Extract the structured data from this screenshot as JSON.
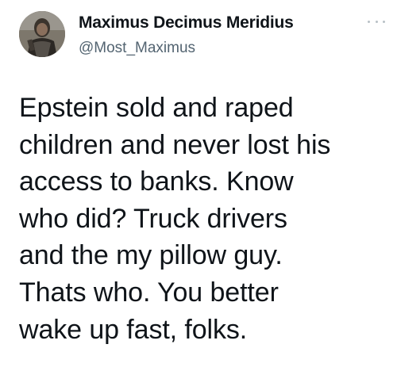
{
  "tweet": {
    "author": {
      "display_name": "Maximus Decimus Meridius",
      "handle": "@Most_Maximus",
      "avatar_icon": "gladiator-avatar"
    },
    "more_icon": "more-options-icon",
    "text_lines": [
      "Epstein sold and raped",
      "children and never lost his",
      "access to banks. Know",
      "who did? Truck drivers",
      "and the my pillow guy.",
      "Thats who. You better",
      "wake up fast, folks."
    ]
  },
  "colors": {
    "text": "#0f1419",
    "secondary_text": "#536471",
    "background": "#ffffff"
  }
}
